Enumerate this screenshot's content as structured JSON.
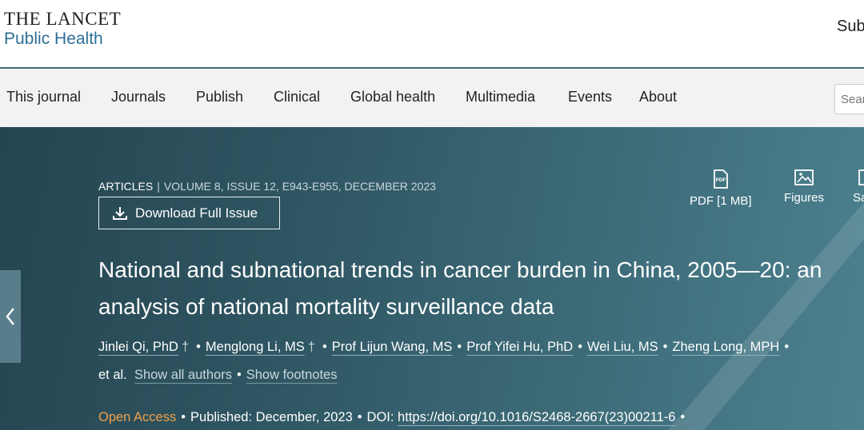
{
  "header": {
    "logo_line1": "THE LANCET",
    "logo_line2": "Public Health",
    "subscribe": "Sub"
  },
  "nav": {
    "items": [
      {
        "label": "This journal"
      },
      {
        "label": "Journals"
      },
      {
        "label": "Publish"
      },
      {
        "label": "Clinical"
      },
      {
        "label": "Global health"
      },
      {
        "label": "Multimedia"
      },
      {
        "label": "Events"
      },
      {
        "label": "About"
      }
    ],
    "search_placeholder": "Sear"
  },
  "article": {
    "section": "ARTICLES",
    "volume_info": "VOLUME 8, ISSUE 12, E943-E955, DECEMBER 2023",
    "download_label": "Download Full Issue",
    "tools": [
      {
        "label": "PDF [1 MB]",
        "icon": "pdf-icon"
      },
      {
        "label": "Figures",
        "icon": "image-icon"
      },
      {
        "label": "Sa",
        "icon": "save-icon"
      }
    ],
    "title": "National and subnational trends in cancer burden in China, 2005—20: an analysis of national mortality surveillance data",
    "authors": [
      {
        "name": "Jinlei Qi, PhD",
        "dagger": "†"
      },
      {
        "name": "Menglong Li, MS",
        "dagger": "†"
      },
      {
        "name": "Prof Lijun Wang, MS"
      },
      {
        "name": "Prof Yifei Hu, PhD"
      },
      {
        "name": "Wei Liu, MS"
      },
      {
        "name": "Zheng Long, MPH"
      }
    ],
    "et_al": "et al.",
    "show_all_authors": "Show all authors",
    "show_footnotes": "Show footnotes",
    "open_access": "Open Access",
    "published_label": "Published:",
    "published_date": "December, 2023",
    "doi_label": "DOI:",
    "doi": "https://doi.org/10.1016/S2468-2667(23)00211-6"
  },
  "colors": {
    "hero_start": "#254550",
    "hero_end": "#4d8190",
    "open_access": "#f0a04b",
    "logo_accent": "#2f6f96"
  }
}
